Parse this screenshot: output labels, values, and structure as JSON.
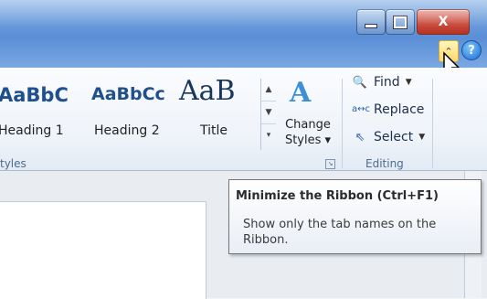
{
  "window": {
    "minimize_glyph": "",
    "maximize_glyph": "",
    "close_glyph": "X"
  },
  "ribbon": {
    "help_glyph": "?",
    "minimize_glyph": "⌃",
    "styles_group": {
      "samples": [
        {
          "sample": "AaBbC",
          "name": "Heading 1"
        },
        {
          "sample": "AaBbCc",
          "name": "Heading 2"
        },
        {
          "sample": "AaB",
          "name": "Title"
        }
      ],
      "change_styles_icon": "A",
      "change_styles_label_line1": "Change",
      "change_styles_label_line2": "Styles ▾",
      "group_label": "tyles"
    },
    "editing_group": {
      "find_label": "Find",
      "replace_label": "Replace",
      "select_label": "Select",
      "group_label": "Editing",
      "find_icon": "binoculars-icon",
      "replace_icon": "replace-icon",
      "select_icon": "cursor-arrow-icon"
    }
  },
  "tooltip": {
    "title": "Minimize the Ribbon (Ctrl+F1)",
    "body": "Show only the tab names on the Ribbon."
  },
  "colors": {
    "titlebar": "#5a8ed6",
    "close_button": "#c8493a",
    "minimize_highlight": "#ffd96b",
    "style_text": "#1f4f8c"
  }
}
